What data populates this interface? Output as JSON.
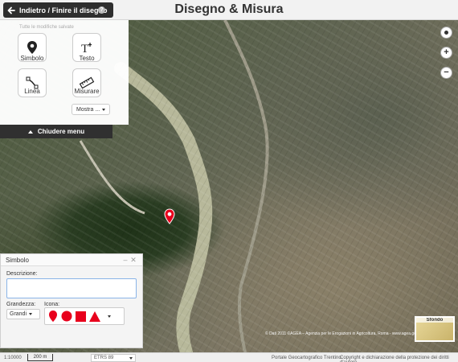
{
  "header": {
    "back_label": "Indietro / Finire il disegno",
    "title": "Disegno & Misura",
    "help_glyph": "?"
  },
  "tools": {
    "note": "Tutte le modifiche salvate",
    "items": [
      {
        "id": "simbolo",
        "label": "Simbolo",
        "icon": "map-pin-icon"
      },
      {
        "id": "testo",
        "label": "Testo",
        "icon": "text-cursor-icon"
      },
      {
        "id": "linea",
        "label": "Linea",
        "icon": "line-icon"
      },
      {
        "id": "misurare",
        "label": "Misurare",
        "icon": "ruler-icon"
      }
    ],
    "show_more_label": "Mostra ...",
    "close_menu_label": "Chiudere menu"
  },
  "dialog": {
    "title": "Simbolo",
    "description_label": "Descrizione:",
    "description_value": "",
    "size_label": "Grandezza:",
    "size_value": "Grandi",
    "icon_label": "Icona:",
    "icons": [
      "pin-shape-icon",
      "circle-shape-icon",
      "square-shape-icon",
      "triangle-shape-icon"
    ],
    "icon_color": "#e8001c"
  },
  "map": {
    "attribution": "© Dati 2011 ©AGEA – Agenzia per le Erogazioni in Agricoltura, Roma - www.agea.gov.it",
    "basemap_label": "Sfondo",
    "marker_color": "#e8001c"
  },
  "footer": {
    "scale": "1:10000",
    "scale_bar_label": "200 m",
    "projection": "ETRS 89",
    "portal_link": "Portale Geocartografico Trentino",
    "copyright_link": "Copyright e dichiarazione della protezione dei diritti d'autore"
  }
}
